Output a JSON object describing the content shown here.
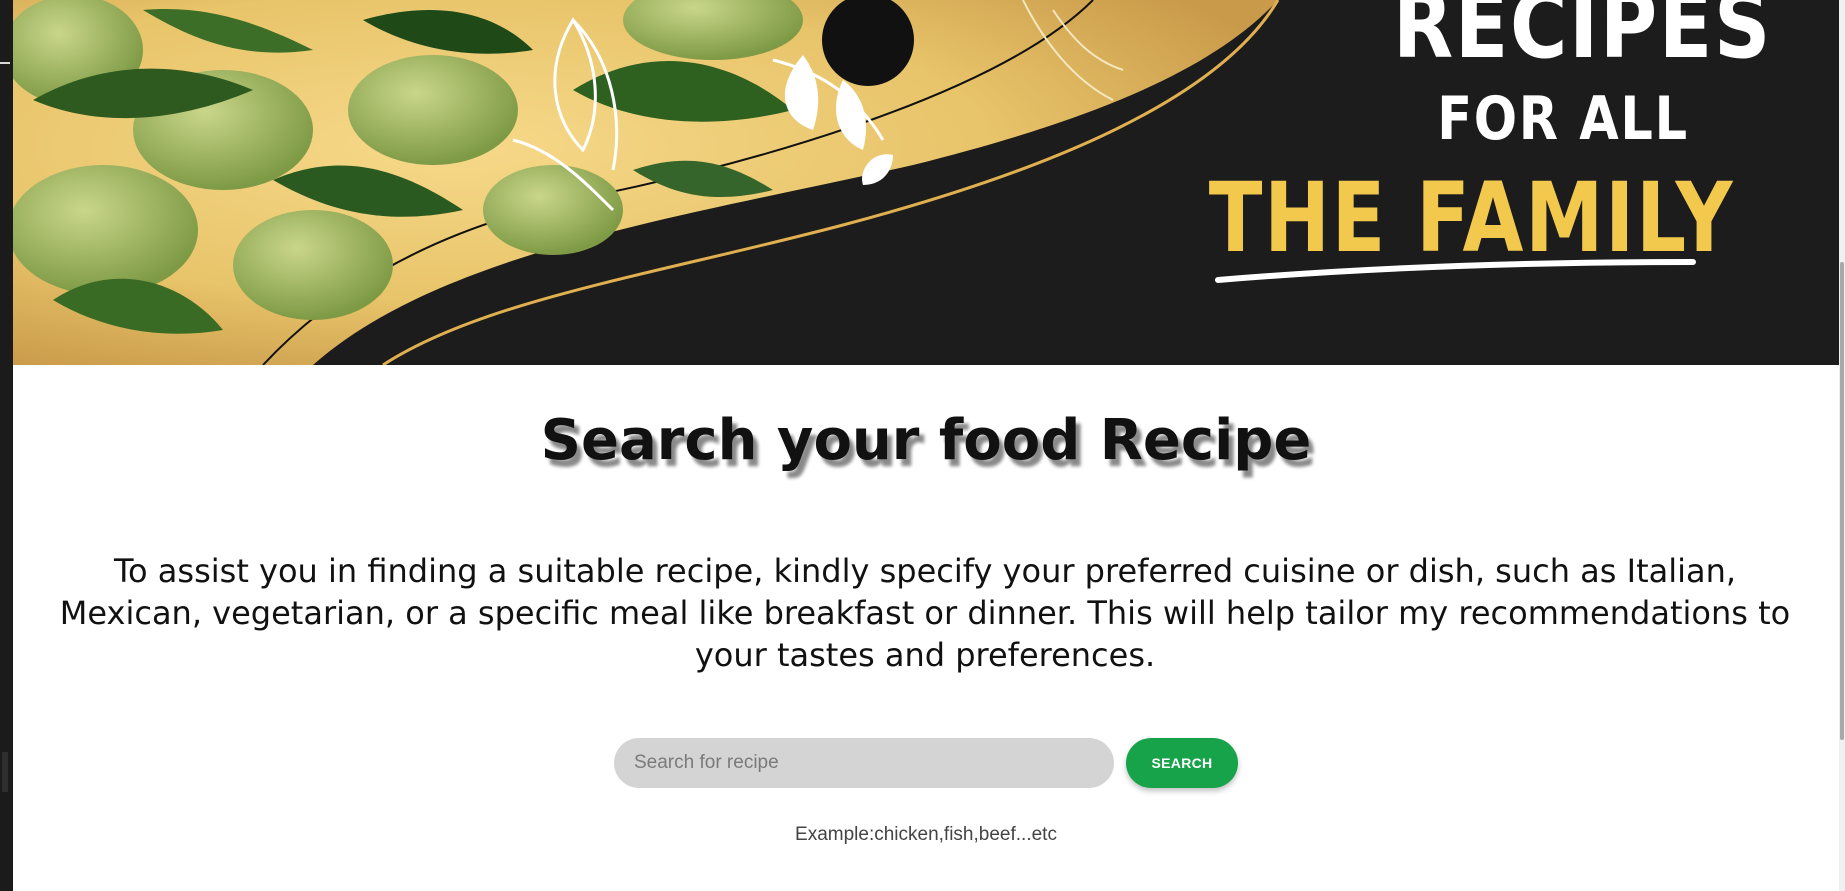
{
  "banner": {
    "alt": "Recipes for all the family banner",
    "line1": "RECIPES",
    "line2": "FOR ALL",
    "line3": "THE FAMILY",
    "accent_color": "#f2c94c",
    "dark_color": "#1c1c1c"
  },
  "main": {
    "title": "Search your food Recipe",
    "description": "To assist you in finding a suitable recipe, kindly specify your preferred cuisine or dish, such as Italian, Mexican, vegetarian, or a specific meal like breakfast or dinner. This will help tailor my recommendations to your tastes and preferences."
  },
  "search": {
    "placeholder": "Search for recipe",
    "value": "",
    "button_label": "SEARCH",
    "button_color": "#16a34a",
    "example": "Example:chicken,fish,beef...etc"
  }
}
